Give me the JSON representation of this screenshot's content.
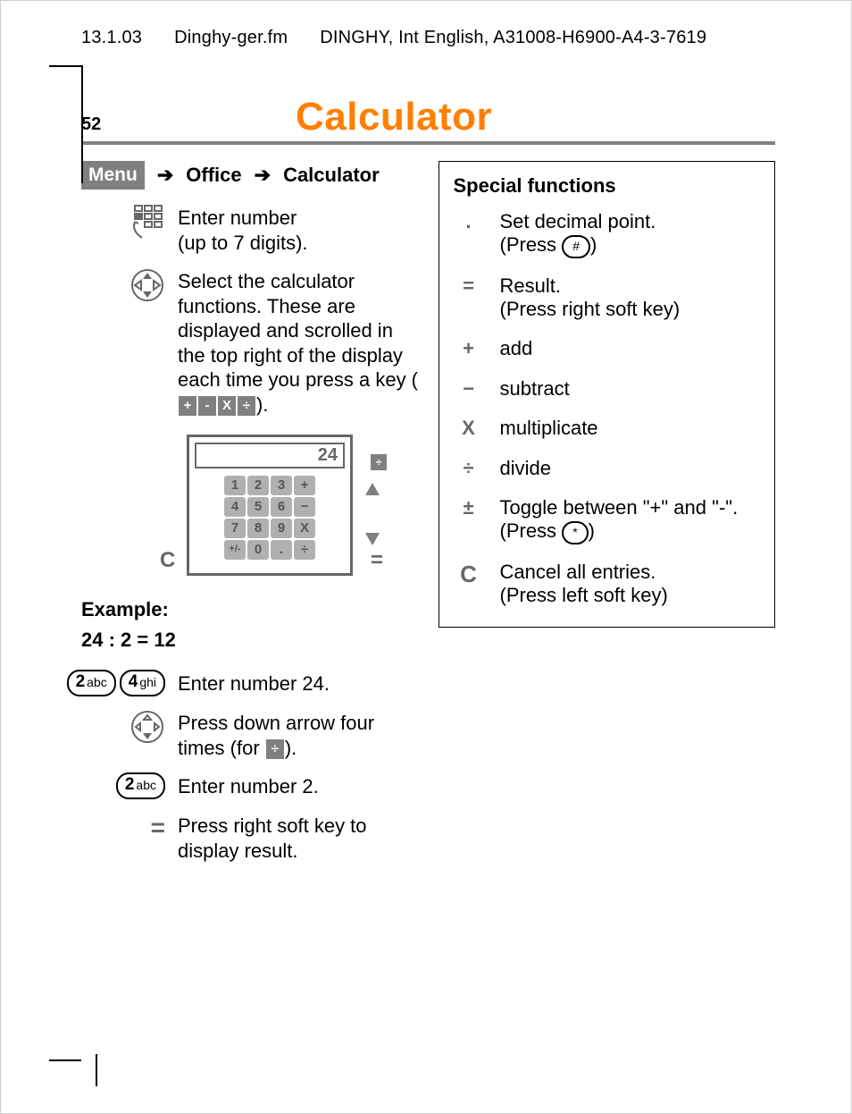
{
  "header": {
    "date": "13.1.03",
    "filename": "Dinghy-ger.fm",
    "doc": "DINGHY, Int English, A31008-H6900-A4-3-7619"
  },
  "page_number": "52",
  "title": "Calculator",
  "breadcrumb": {
    "menu": "Menu",
    "office": "Office",
    "calculator": "Calculator"
  },
  "instructions": {
    "enter_number": "Enter number\n(up to 7 digits).",
    "select_func_1": "Select the calculator functions. These are displayed and scrolled in the top right of the display each time you press a key (",
    "select_func_2": ").",
    "op_chips": {
      "plus": "+",
      "minus": "-",
      "times": "X",
      "div": "÷"
    }
  },
  "calc_mock": {
    "display_value": "24",
    "rows": [
      [
        "1",
        "2",
        "3",
        "+"
      ],
      [
        "4",
        "5",
        "6",
        "−"
      ],
      [
        "7",
        "8",
        "9",
        "X"
      ],
      [
        "+/-",
        "0",
        ".",
        "÷"
      ]
    ],
    "left_soft": "C",
    "right_soft": "=",
    "side_chip": "÷"
  },
  "example": {
    "heading": "Example:",
    "expr": "24 : 2 = 12",
    "steps": [
      {
        "keys": [
          {
            "main": "2",
            "sub": "abc"
          },
          {
            "main": "4",
            "sub": "ghi"
          }
        ],
        "text": "Enter number 24."
      },
      {
        "nav": true,
        "text_1": "Press down arrow four times (for",
        "text_2": ")."
      },
      {
        "keys": [
          {
            "main": "2",
            "sub": "abc"
          }
        ],
        "text": "Enter number 2."
      },
      {
        "eq": "=",
        "text": "Press right soft key to display result."
      }
    ]
  },
  "special": {
    "title": "Special functions",
    "rows": [
      {
        "sym": ".",
        "text_1": "Set decimal point.",
        "text_2": "(Press ",
        "pill": "#",
        "text_3": ")"
      },
      {
        "sym": "=",
        "text": "Result.\n(Press right soft key)"
      },
      {
        "sym": "+",
        "text": "add"
      },
      {
        "sym": "−",
        "text": "subtract"
      },
      {
        "sym": "X",
        "text": "multiplicate"
      },
      {
        "sym": "÷",
        "text": "divide"
      },
      {
        "sym": "±",
        "text_1": "Toggle between \"+\" and \"-\".",
        "text_2": "(Press ",
        "pill": "*",
        "text_3": ")"
      },
      {
        "sym": "C",
        "text": "Cancel all entries.\n(Press left soft key)"
      }
    ]
  }
}
